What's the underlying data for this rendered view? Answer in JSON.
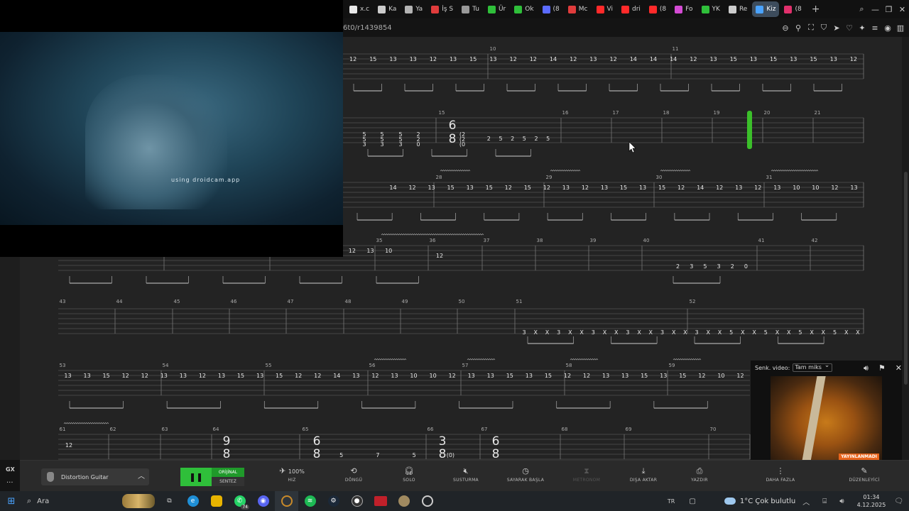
{
  "browser": {
    "tabs": [
      {
        "label": "x.c",
        "color": "#e8e8e8",
        "glyph": "X"
      },
      {
        "label": "Ka",
        "color": "#cccccc",
        "glyph": "⌂"
      },
      {
        "label": "Ya",
        "color": "#b3b3b3",
        "glyph": "›"
      },
      {
        "label": "İş S",
        "color": "#e03c3c",
        "glyph": "›"
      },
      {
        "label": "Tu",
        "color": "#999999",
        "glyph": "›"
      },
      {
        "label": "Ür",
        "color": "#2fbf3a",
        "glyph": ""
      },
      {
        "label": "Ok",
        "color": "#2fbf3a",
        "glyph": ""
      },
      {
        "label": "(8",
        "color": "#5b6bff",
        "glyph": ""
      },
      {
        "label": "Mc",
        "color": "#e03c3c",
        "glyph": ""
      },
      {
        "label": "Vi",
        "color": "#ff2a2a",
        "glyph": ""
      },
      {
        "label": "dri",
        "color": "#ff2a2a",
        "glyph": ""
      },
      {
        "label": "(8",
        "color": "#ff2a2a",
        "glyph": ""
      },
      {
        "label": "Fo",
        "color": "#d44bd4",
        "glyph": ""
      },
      {
        "label": "YK",
        "color": "#2fbf3a",
        "glyph": ""
      },
      {
        "label": "Re",
        "color": "#cccccc",
        "glyph": ""
      },
      {
        "label": "Kiz",
        "color": "#4aa3ff",
        "glyph": "",
        "active": true
      },
      {
        "label": "(8",
        "color": "#e1306c",
        "glyph": ""
      }
    ],
    "new_tab": "+",
    "url": "6t0/r1439854"
  },
  "webcam": {
    "overlay_text": "using droidcam.app"
  },
  "tab": {
    "row1": {
      "measures": [
        "10",
        "11"
      ],
      "notes": [
        "12",
        "15",
        "13",
        "13",
        "12",
        "13",
        "15",
        "13",
        "12",
        "12",
        "14",
        "12",
        "13",
        "12",
        "14",
        "14",
        "14",
        "12",
        "13",
        "15",
        "13",
        "15",
        "13",
        "15",
        "13",
        "12"
      ]
    },
    "row2": {
      "measures": [
        "15",
        "16",
        "17",
        "18",
        "19",
        "20",
        "21"
      ],
      "time_sig": {
        "top": "6",
        "bottom": "8"
      },
      "chords": [
        [
          "5",
          "5",
          "3"
        ],
        [
          "5",
          "5",
          "3"
        ],
        [
          "5",
          "5",
          "3"
        ],
        [
          "2",
          "2",
          "0"
        ],
        [
          "(2",
          "(2",
          "(0"
        ]
      ],
      "notes": [
        "2",
        "5",
        "2",
        "5",
        "2",
        "5"
      ]
    },
    "row3": {
      "measures": [
        "28",
        "29",
        "30",
        "31"
      ],
      "notes": [
        "14",
        "12",
        "13",
        "15",
        "13",
        "15",
        "12",
        "15",
        "12",
        "13",
        "12",
        "13",
        "15",
        "13",
        "15",
        "12",
        "14",
        "12",
        "13",
        "12",
        "13",
        "10",
        "10",
        "12",
        "13"
      ]
    },
    "row4": {
      "measures": [
        "35",
        "36",
        "37",
        "38",
        "39",
        "40",
        "41",
        "42"
      ],
      "notes": [
        "12",
        "13",
        "10",
        "12",
        "2",
        "3",
        "5",
        "3",
        "2",
        "0"
      ]
    },
    "row5": {
      "measures": [
        "43",
        "44",
        "45",
        "46",
        "47",
        "48",
        "49",
        "50",
        "51",
        "52"
      ],
      "muted": [
        "3",
        "X",
        "X",
        "3",
        "X",
        "X",
        "3",
        "X",
        "X",
        "3",
        "X",
        "X",
        "3",
        "X",
        "X",
        "3",
        "X",
        "X",
        "5",
        "X",
        "X",
        "5",
        "X",
        "X",
        "5",
        "X",
        "X",
        "5",
        "X",
        "X"
      ]
    },
    "row6": {
      "measures": [
        "53",
        "54",
        "55",
        "56",
        "57",
        "58",
        "59"
      ],
      "notes": [
        "13",
        "13",
        "15",
        "12",
        "12",
        "13",
        "13",
        "12",
        "13",
        "15",
        "13",
        "15",
        "12",
        "12",
        "14",
        "13",
        "12",
        "13",
        "10",
        "10",
        "12",
        "13",
        "13",
        "15",
        "13",
        "15",
        "12",
        "12",
        "13",
        "13",
        "15",
        "13",
        "15",
        "12",
        "10",
        "12"
      ]
    },
    "row7": {
      "measures": [
        "61",
        "62",
        "63",
        "64",
        "65",
        "66",
        "67",
        "68",
        "69",
        "70"
      ],
      "notes": [
        "12",
        "5",
        "7",
        "5",
        "(0)"
      ],
      "time_sigs": [
        {
          "top": "9",
          "bottom": "8"
        },
        {
          "top": "6",
          "bottom": "8"
        },
        {
          "top": "3",
          "bottom": "8"
        },
        {
          "top": "6",
          "bottom": "8"
        }
      ]
    }
  },
  "floating_video": {
    "label": "Senk. video:",
    "select_value": "Tam miks",
    "badge": "YAYINLANMADI"
  },
  "toolbar": {
    "instrument": "Distortion Guitar",
    "original_label": "ORİJİNAL",
    "synth_label": "SENTEZ",
    "speed_value": "100%",
    "speed_label": "HIZ",
    "loop_label": "DÖNGÜ",
    "solo_label": "SOLO",
    "mute_label": "SUSTURMA",
    "countin_label": "SAYARAK BAŞLA",
    "metronome_label": "METRONOM",
    "export_label": "DIŞA AKTAR",
    "print_label": "YAZDIR",
    "more_label": "DAHA FAZLA",
    "editor_label": "DÜZENLEYİCİ"
  },
  "sidebar": {
    "gx": "GX",
    "dots": "···"
  },
  "taskbar": {
    "search_placeholder": "Ara",
    "whatsapp_badge": "74",
    "language": "TR",
    "weather": "1°C  Çok bulutlu",
    "time": "01:34",
    "date": "4.12.2025"
  }
}
